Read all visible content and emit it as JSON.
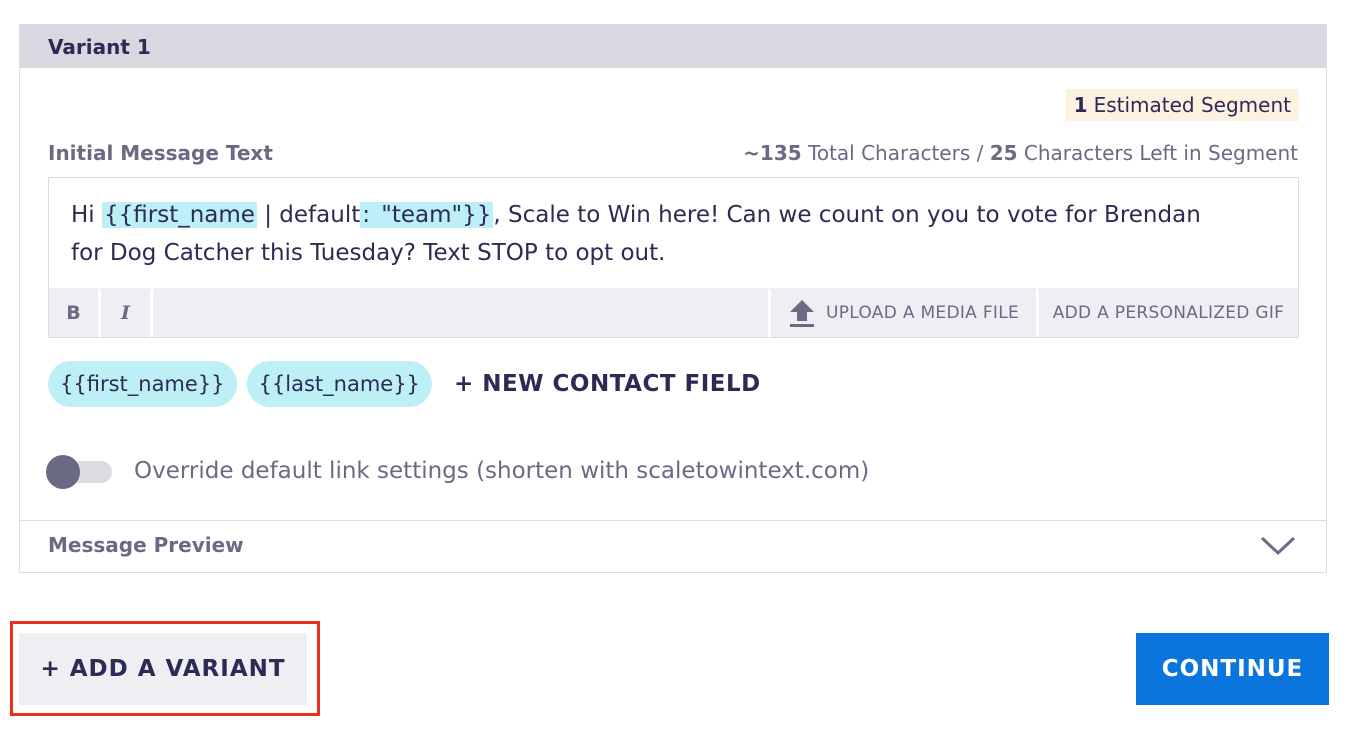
{
  "variant": {
    "title": "Variant 1",
    "segment_count": "1",
    "segment_label": "Estimated Segment",
    "field_label": "Initial Message Text",
    "char_count": {
      "total": "~135",
      "total_label": "Total Characters /",
      "left": "25",
      "left_label": "Characters Left in Segment"
    },
    "message": {
      "prefix": "Hi ",
      "token_field": "{{first_name",
      "token_default": " | default",
      "token_colon": ":",
      "token_value": " \"team\"}}",
      "suffix": ", Scale to Win here! Can we count on you to vote for Brendan for Dog Catcher this Tuesday? Text STOP to opt out."
    },
    "toolbar": {
      "bold": "B",
      "italic": "I",
      "upload_label": "UPLOAD A MEDIA FILE",
      "gif_label": "ADD A PERSONALIZED GIF"
    },
    "chips": [
      "{{first_name}}",
      "{{last_name}}"
    ],
    "new_field_label": "+ NEW CONTACT FIELD",
    "toggle_label": "Override default link settings (shorten with scaletowintext.com)",
    "toggle_on": false,
    "preview_label": "Message Preview"
  },
  "actions": {
    "add_variant": "+ ADD A VARIANT",
    "continue": "CONTINUE"
  },
  "colors": {
    "accent": "#0a75dd",
    "token_bg": "#bdeff7",
    "highlight": "#e8321f"
  }
}
